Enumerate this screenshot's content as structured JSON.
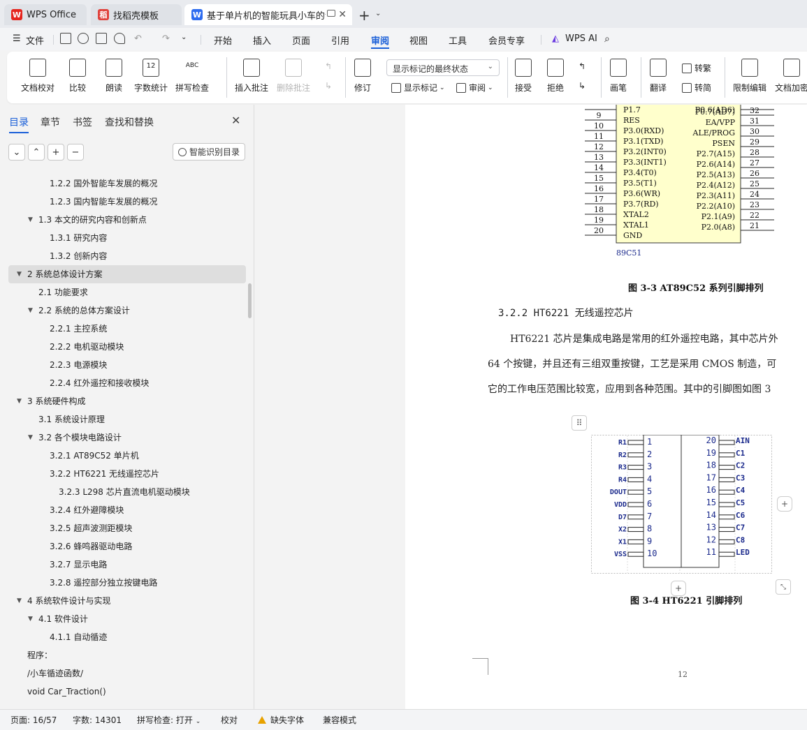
{
  "tabs": [
    {
      "label": "WPS Office"
    },
    {
      "label": "找稻壳模板"
    },
    {
      "label": "基于单片机的智能玩具小车的设"
    }
  ],
  "menubar": {
    "file": "文件",
    "items": [
      "开始",
      "插入",
      "页面",
      "引用",
      "审阅",
      "视图",
      "工具",
      "会员专享"
    ],
    "active": "审阅",
    "ai": "WPS AI"
  },
  "ribbon": {
    "doc_proof": "文档校对",
    "compare": "比较",
    "read_aloud": "朗读",
    "word_count": "字数统计",
    "spell_check": "拼写检查",
    "insert_comment": "插入批注",
    "delete_comment": "删除批注",
    "track": "修订",
    "display_mode": "显示标记的最终状态",
    "show_markup": "显示标记",
    "review_pane": "审阅",
    "accept": "接受",
    "reject": "拒绝",
    "pen": "画笔",
    "translate": "翻译",
    "to_trad": "转繁",
    "to_simp": "转简",
    "restrict": "限制编辑",
    "encrypt": "文档加密",
    "word_count_icon_text": "12",
    "spell_icon_text": "ABC"
  },
  "sidebar": {
    "tabs": [
      "目录",
      "章节",
      "书签",
      "查找和替换"
    ],
    "smart_btn": "智能识别目录",
    "toc": [
      {
        "text": "1.2.2  国外智能车发展的概况",
        "level": 3
      },
      {
        "text": "1.2.3  国内智能车发展的概况",
        "level": 3
      },
      {
        "text": "1.3  本文的研究内容和创新点",
        "level": 2,
        "expanded": true
      },
      {
        "text": "1.3.1  研究内容",
        "level": 3
      },
      {
        "text": "1.3.2  创新内容",
        "level": 3
      },
      {
        "text": "2  系统总体设计方案",
        "level": 1,
        "expanded": true,
        "selected": true
      },
      {
        "text": "2.1 功能要求",
        "level": 2
      },
      {
        "text": "2.2 系统的总体方案设计",
        "level": 2,
        "expanded": true
      },
      {
        "text": "2.2.1 主控系统",
        "level": 3
      },
      {
        "text": "2.2.2 电机驱动模块",
        "level": 3
      },
      {
        "text": "2.2.3 电源模块",
        "level": 3
      },
      {
        "text": "2.2.4  红外遥控和接收模块",
        "level": 3
      },
      {
        "text": "3  系统硬件构成",
        "level": 1,
        "expanded": true
      },
      {
        "text": "3.1  系统设计原理",
        "level": 2
      },
      {
        "text": "3.2  各个模块电路设计",
        "level": 2,
        "expanded": true
      },
      {
        "text": "3.2.1 AT89C52 单片机",
        "level": 3
      },
      {
        "text": "3.2.2 HT6221 无线遥控芯片",
        "level": 3
      },
      {
        "text": "3.2.3 L298 芯片直流电机驱动模块",
        "level": 4
      },
      {
        "text": "3.2.4  红外避障模块",
        "level": 3
      },
      {
        "text": "3.2.5  超声波测距模块",
        "level": 3
      },
      {
        "text": "3.2.6  蜂鸣器驱动电路",
        "level": 3
      },
      {
        "text": "3.2.7  显示电路",
        "level": 3
      },
      {
        "text": "3.2.8  遥控部分独立按键电路",
        "level": 3
      },
      {
        "text": "4  系统软件设计与实现",
        "level": 1,
        "expanded": true
      },
      {
        "text": "4.1 软件设计",
        "level": 2,
        "expanded": true
      },
      {
        "text": "4.1.1 自动循迹",
        "level": 3
      },
      {
        "text": "程序：",
        "level": 0
      },
      {
        "text": "/小车循迹函数/",
        "level": 0
      },
      {
        "text": "void Car_Traction()",
        "level": 0
      }
    ]
  },
  "document": {
    "chip1": {
      "name": "89C51",
      "left_pins": [
        {
          "n": "9",
          "label": "RES"
        },
        {
          "n": "10",
          "label": "P3.0(RXD)"
        },
        {
          "n": "11",
          "label": "P3.1(TXD)"
        },
        {
          "n": "12",
          "label": "P3.2(INT0)"
        },
        {
          "n": "13",
          "label": "P3.3(INT1)"
        },
        {
          "n": "14",
          "label": "P3.4(T0)"
        },
        {
          "n": "15",
          "label": "P3.5(T1)"
        },
        {
          "n": "16",
          "label": "P3.6(WR)"
        },
        {
          "n": "17",
          "label": "P3.7(RD)"
        },
        {
          "n": "18",
          "label": "XTAL2"
        },
        {
          "n": "19",
          "label": "XTAL1"
        },
        {
          "n": "20",
          "label": "GND"
        }
      ],
      "right_pins": [
        {
          "n": "32",
          "label": "P0.7(AD7)"
        },
        {
          "n": "31",
          "label": "EA/VPP"
        },
        {
          "n": "30",
          "label": "ALE/PROG"
        },
        {
          "n": "29",
          "label": "PSEN"
        },
        {
          "n": "28",
          "label": "P2.7(A15)"
        },
        {
          "n": "27",
          "label": "P2.6(A14)"
        },
        {
          "n": "26",
          "label": "P2.5(A13)"
        },
        {
          "n": "25",
          "label": "P2.4(A12)"
        },
        {
          "n": "24",
          "label": "P2.3(A11)"
        },
        {
          "n": "23",
          "label": "P2.2(A10)"
        },
        {
          "n": "22",
          "label": "P2.1(A9)"
        },
        {
          "n": "21",
          "label": "P2.0(A8)"
        }
      ],
      "top_left": {
        "label": "P1.7"
      },
      "top_right": {
        "label": "P0.6(AD6)"
      }
    },
    "caption1": "图 3-3 AT89C52 系列引脚排列",
    "heading": "3.2.2 HT6221 无线遥控芯片",
    "para1": "HT6221 芯片是集成电路是常用的红外遥控电路，其中芯片外",
    "para2": "64 个按键，并且还有三组双重按键，工艺是采用 CMOS 制造，可",
    "para3": "它的工作电压范围比较宽，应用到各种范围。其中的引脚图如图 3",
    "chip2": {
      "left_pins": [
        {
          "n": "1",
          "label": "R1"
        },
        {
          "n": "2",
          "label": "R2"
        },
        {
          "n": "3",
          "label": "R3"
        },
        {
          "n": "4",
          "label": "R4"
        },
        {
          "n": "5",
          "label": "DOUT"
        },
        {
          "n": "6",
          "label": "VDD"
        },
        {
          "n": "7",
          "label": "D7"
        },
        {
          "n": "8",
          "label": "X2"
        },
        {
          "n": "9",
          "label": "X1"
        },
        {
          "n": "10",
          "label": "VSS"
        }
      ],
      "right_pins": [
        {
          "n": "20",
          "label": "AIN"
        },
        {
          "n": "19",
          "label": "C1"
        },
        {
          "n": "18",
          "label": "C2"
        },
        {
          "n": "17",
          "label": "C3"
        },
        {
          "n": "16",
          "label": "C4"
        },
        {
          "n": "15",
          "label": "C5"
        },
        {
          "n": "14",
          "label": "C6"
        },
        {
          "n": "13",
          "label": "C7"
        },
        {
          "n": "12",
          "label": "C8"
        },
        {
          "n": "11",
          "label": "LED"
        }
      ]
    },
    "caption2": "图 3-4 HT6221 引脚排列",
    "page_number": "12"
  },
  "status": {
    "page": "页面: 16/57",
    "words": "字数: 14301",
    "spell": "拼写检查: 打开",
    "proof": "校对",
    "missing_font": "缺失字体",
    "compat": "兼容模式"
  },
  "colors": {
    "accent": "#1a5fd8",
    "chip_fill": "#ffffcc",
    "pin_label_blue": "#1b2a8c"
  }
}
